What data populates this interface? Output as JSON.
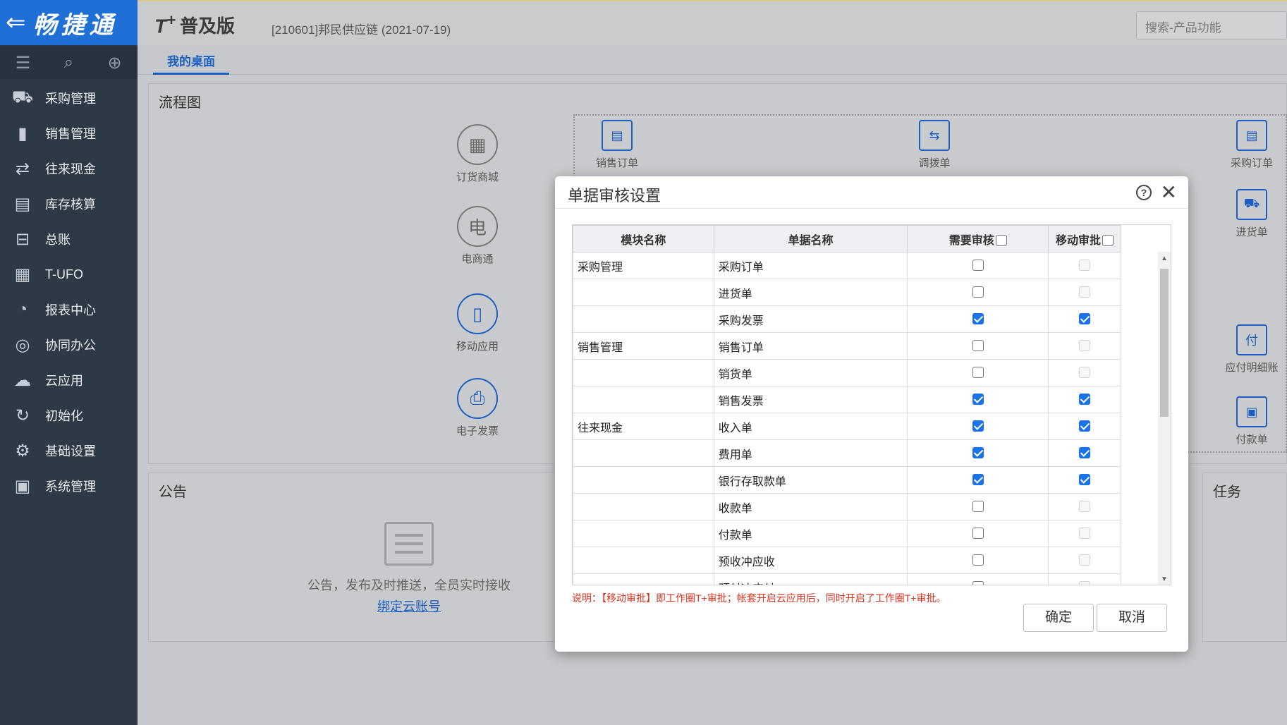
{
  "app": {
    "logo": "畅捷通",
    "brand": "T",
    "brand_plus": "+",
    "edition": "普及版",
    "account": "[210601]邦民供应链   (2021-07-19)",
    "search_placeholder": "搜索-产品功能"
  },
  "sidebar": {
    "items": [
      {
        "label": "采购管理",
        "icon": "purchase-icon"
      },
      {
        "label": "销售管理",
        "icon": "sales-chart-icon"
      },
      {
        "label": "往来现金",
        "icon": "exchange-icon"
      },
      {
        "label": "库存核算",
        "icon": "inventory-icon"
      },
      {
        "label": "总账",
        "icon": "ledger-icon"
      },
      {
        "label": "T-UFO",
        "icon": "ufo-doc-icon"
      },
      {
        "label": "报表中心",
        "icon": "pie-chart-icon"
      },
      {
        "label": "协同办公",
        "icon": "collab-icon"
      },
      {
        "label": "云应用",
        "icon": "cloud-icon"
      },
      {
        "label": "初始化",
        "icon": "refresh-icon"
      },
      {
        "label": "基础设置",
        "icon": "settings-icon"
      },
      {
        "label": "系统管理",
        "icon": "system-icon"
      }
    ]
  },
  "tabs": {
    "desktop": "我的桌面"
  },
  "flow": {
    "title": "流程图",
    "nodes": {
      "order_mall": "订货商城",
      "ecommerce": "电商通",
      "mobile_app": "移动应用",
      "e_invoice": "电子发票",
      "sales_order": "销售订单",
      "transfer": "调拨单",
      "purchase_order": "采购订单",
      "receipt": "进货单",
      "payable_detail": "应付明细账",
      "payment": "付款单"
    }
  },
  "notice": {
    "title": "公告",
    "empty_text": "公告，发布及时推送，全员实时接收",
    "bind_link": "绑定云账号"
  },
  "task": {
    "title": "任务"
  },
  "dialog": {
    "title": "单据审核设置",
    "columns": {
      "module": "模块名称",
      "doc": "单据名称",
      "need_review": "需要审核",
      "mobile": "移动审批"
    },
    "rows": [
      {
        "module": "采购管理",
        "doc": "采购订单",
        "review": false,
        "mobile": false,
        "mobile_enabled": false
      },
      {
        "module": "",
        "doc": "进货单",
        "review": false,
        "mobile": false,
        "mobile_enabled": false
      },
      {
        "module": "",
        "doc": "采购发票",
        "review": true,
        "mobile": true,
        "mobile_enabled": true
      },
      {
        "module": "销售管理",
        "doc": "销售订单",
        "review": false,
        "mobile": false,
        "mobile_enabled": false
      },
      {
        "module": "",
        "doc": "销货单",
        "review": false,
        "mobile": false,
        "mobile_enabled": false
      },
      {
        "module": "",
        "doc": "销售发票",
        "review": true,
        "mobile": true,
        "mobile_enabled": true
      },
      {
        "module": "往来现金",
        "doc": "收入单",
        "review": true,
        "mobile": true,
        "mobile_enabled": true
      },
      {
        "module": "",
        "doc": "费用单",
        "review": true,
        "mobile": true,
        "mobile_enabled": true
      },
      {
        "module": "",
        "doc": "银行存取款单",
        "review": true,
        "mobile": true,
        "mobile_enabled": true
      },
      {
        "module": "",
        "doc": "收款单",
        "review": false,
        "mobile": false,
        "mobile_enabled": false
      },
      {
        "module": "",
        "doc": "付款单",
        "review": false,
        "mobile": false,
        "mobile_enabled": false
      },
      {
        "module": "",
        "doc": "预收冲应收",
        "review": false,
        "mobile": false,
        "mobile_enabled": false
      },
      {
        "module": "",
        "doc": "预付冲应付",
        "review": false,
        "mobile": false,
        "mobile_enabled": false
      }
    ],
    "note": "说明：【移动审批】即工作圈T+审批；帐套开启云应用后，同时开启了工作圈T+审批。",
    "ok": "确定",
    "cancel": "取消"
  },
  "colors": {
    "sidebar": "#2f3946",
    "logo_bg": "#1e6fd6",
    "accent": "#1c5fc2",
    "checked": "#1a73e8",
    "note": "#d9331f"
  }
}
